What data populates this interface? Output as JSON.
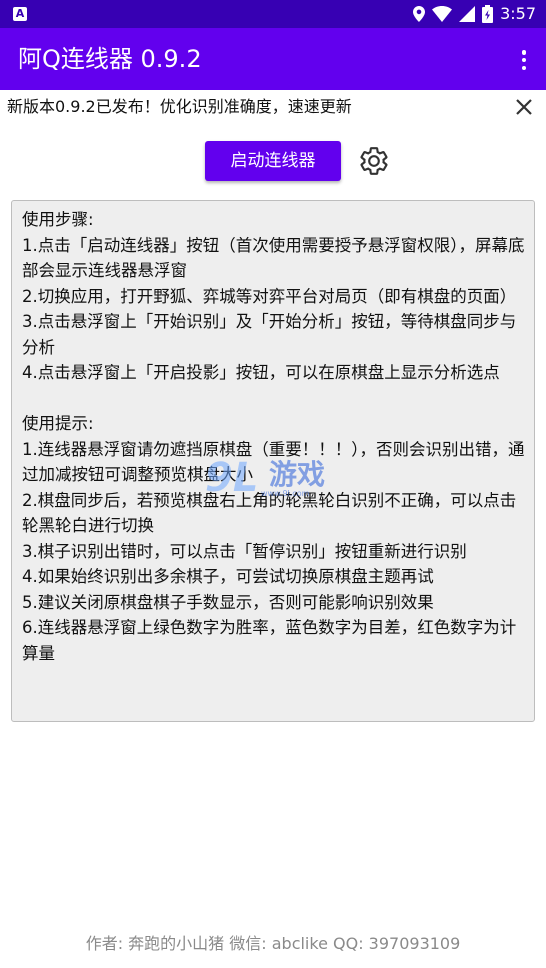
{
  "status_bar": {
    "time": "3:57",
    "icons": [
      "notification-a-icon",
      "location-icon",
      "wifi-icon",
      "signal-icon",
      "battery-icon"
    ]
  },
  "app_bar": {
    "title": "阿Q连线器 0.9.2",
    "overflow_icon": "more-vert-icon",
    "colors": {
      "primary": "#6200ee",
      "primary_dark": "#3700b3"
    }
  },
  "notice": {
    "text": "新版本0.9.2已发布！优化识别准确度，速速更新",
    "close_icon": "close-icon"
  },
  "controls": {
    "start_label": "启动连线器",
    "settings_icon": "gear-icon"
  },
  "instructions": {
    "usage_title": "使用步骤:",
    "usage_steps": [
      "1.点击「启动连线器」按钮（首次使用需要授予悬浮窗权限），屏幕底部会显示连线器悬浮窗",
      "2.切换应用，打开野狐、弈城等对弈平台对局页（即有棋盘的页面）",
      "3.点击悬浮窗上「开始识别」及「开始分析」按钮，等待棋盘同步与分析",
      "4.点击悬浮窗上「开启投影」按钮，可以在原棋盘上显示分析选点"
    ],
    "tips_title": "使用提示:",
    "tips": [
      "1.连线器悬浮窗请勿遮挡原棋盘（重要！！！），否则会识别出错，通过加减按钮可调整预览棋盘大小",
      "2.棋盘同步后，若预览棋盘右上角的轮黑轮白识别不正确，可以点击轮黑轮白进行切换",
      "3.棋子识别出错时，可以点击「暂停识别」按钮重新进行识别",
      "4.如果始终识别出多余棋子，可尝试切换原棋盘主题再试",
      "5.建议关闭原棋盘棋子手数显示，否则可能影响识别效果",
      "6.连线器悬浮窗上绿色数字为胜率，蓝色数字为目差，红色数字为计算量"
    ]
  },
  "watermark": {
    "logo": "9L",
    "text": "游戏",
    "url": "www.9l.com"
  },
  "footer": {
    "text": "作者: 奔跑的小山猪 微信: abclike QQ: 397093109"
  }
}
